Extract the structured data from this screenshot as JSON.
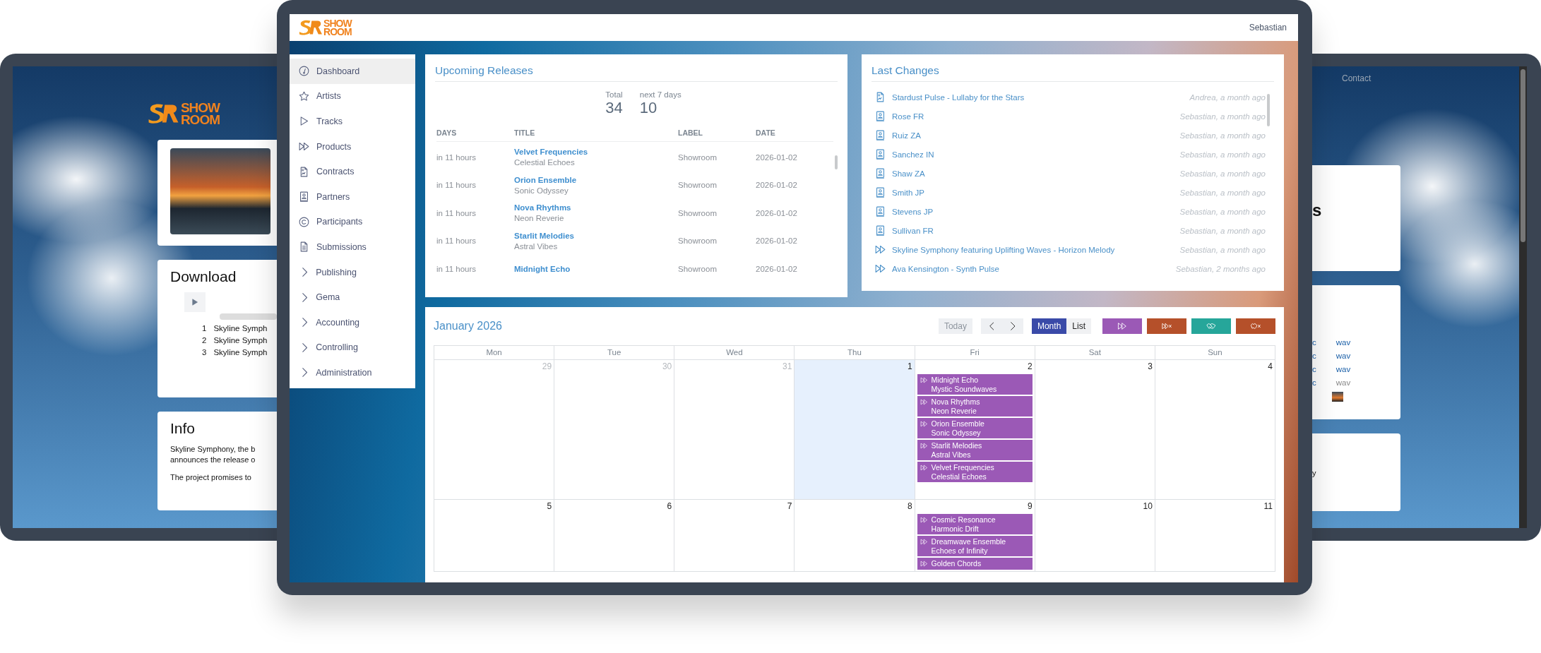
{
  "left_preview": {
    "logo": {
      "line1": "SHOW",
      "line2": "ROOM"
    },
    "download": {
      "title": "Download",
      "tracks": [
        {
          "number": "1",
          "title": "Skyline Symph"
        },
        {
          "number": "2",
          "title": "Skyline Symph"
        },
        {
          "number": "3",
          "title": "Skyline Symph"
        }
      ]
    },
    "info": {
      "title": "Info",
      "paragraphs": [
        [
          "Skyline Symphony, the b",
          "announces the release o"
        ],
        [
          "The project promises to"
        ]
      ]
    }
  },
  "right_preview": {
    "nav_link": "Contact",
    "heading": "s",
    "files": [
      {
        "format": "c",
        "file": "wav",
        "available": true
      },
      {
        "format": "c",
        "file": "wav",
        "available": true
      },
      {
        "format": "c",
        "file": "wav",
        "available": true
      },
      {
        "format": "c",
        "file": "wav",
        "available": false
      }
    ],
    "info_text": "y"
  },
  "app": {
    "logo": {
      "line1": "SHOW",
      "line2": "ROOM"
    },
    "user": "Sebastian",
    "sidebar": {
      "items": [
        {
          "label": "Dashboard",
          "kind": "page",
          "selected": true
        },
        {
          "label": "Artists",
          "kind": "page",
          "selected": false
        },
        {
          "label": "Tracks",
          "kind": "page",
          "selected": false
        },
        {
          "label": "Products",
          "kind": "page",
          "selected": false
        },
        {
          "label": "Contracts",
          "kind": "page",
          "selected": false
        },
        {
          "label": "Partners",
          "kind": "page",
          "selected": false
        },
        {
          "label": "Participants",
          "kind": "page",
          "selected": false
        },
        {
          "label": "Submissions",
          "kind": "page",
          "selected": false
        },
        {
          "label": "Publishing",
          "kind": "group",
          "selected": false
        },
        {
          "label": "Gema",
          "kind": "group",
          "selected": false
        },
        {
          "label": "Accounting",
          "kind": "group",
          "selected": false
        },
        {
          "label": "Controlling",
          "kind": "group",
          "selected": false
        },
        {
          "label": "Administration",
          "kind": "group",
          "selected": false
        }
      ]
    },
    "upcoming_releases": {
      "title": "Upcoming Releases",
      "stats": [
        {
          "label": "Total",
          "value": "34"
        },
        {
          "label": "next 7 days",
          "value": "10"
        }
      ],
      "columns": [
        "DAYS",
        "TITLE",
        "LABEL",
        "DATE"
      ],
      "rows": [
        {
          "days": "in 11 hours",
          "title": "Velvet Frequencies",
          "subtitle": "Celestial Echoes",
          "label": "Showroom",
          "date": "2026-01-02"
        },
        {
          "days": "in 11 hours",
          "title": "Orion Ensemble",
          "subtitle": "Sonic Odyssey",
          "label": "Showroom",
          "date": "2026-01-02"
        },
        {
          "days": "in 11 hours",
          "title": "Nova Rhythms",
          "subtitle": "Neon Reverie",
          "label": "Showroom",
          "date": "2026-01-02"
        },
        {
          "days": "in 11 hours",
          "title": "Starlit Melodies",
          "subtitle": "Astral Vibes",
          "label": "Showroom",
          "date": "2026-01-02"
        },
        {
          "days": "in 11 hours",
          "title": "Midnight Echo",
          "label": "Showroom",
          "date": "2026-01-02"
        }
      ]
    },
    "last_changes": {
      "title": "Last Changes",
      "items": [
        {
          "kind": "contract",
          "title": "Stardust Pulse - Lullaby for the Stars",
          "meta": "Andrea, a month ago"
        },
        {
          "kind": "partner",
          "title": "Rose FR",
          "meta": "Sebastian, a month ago"
        },
        {
          "kind": "partner",
          "title": "Ruiz ZA",
          "meta": "Sebastian, a month ago"
        },
        {
          "kind": "partner",
          "title": "Sanchez IN",
          "meta": "Sebastian, a month ago"
        },
        {
          "kind": "partner",
          "title": "Shaw ZA",
          "meta": "Sebastian, a month ago"
        },
        {
          "kind": "partner",
          "title": "Smith JP",
          "meta": "Sebastian, a month ago"
        },
        {
          "kind": "partner",
          "title": "Stevens JP",
          "meta": "Sebastian, a month ago"
        },
        {
          "kind": "partner",
          "title": "Sullivan FR",
          "meta": "Sebastian, a month ago"
        },
        {
          "kind": "product",
          "title": "Skyline Symphony featuring Uplifting Waves - Horizon Melody",
          "meta": "Sebastian, a month ago"
        },
        {
          "kind": "product",
          "title": "Ava Kensington - Synth Pulse",
          "meta": "Sebastian, 2 months ago"
        }
      ]
    },
    "calendar": {
      "title": "January 2026",
      "today_button": {
        "label": "Today",
        "disabled": true
      },
      "view_buttons": [
        {
          "label": "Month",
          "selected": true
        },
        {
          "label": "List",
          "selected": false
        }
      ],
      "action_buttons": [
        {
          "kind": "products",
          "color": "#9b59b6"
        },
        {
          "kind": "products_off",
          "color": "#b5502a"
        },
        {
          "kind": "deals",
          "color": "#26a69a"
        },
        {
          "kind": "deals_off",
          "color": "#b5502a"
        }
      ],
      "weekdays": [
        "Mon",
        "Tue",
        "Wed",
        "Thu",
        "Fri",
        "Sat",
        "Sun"
      ],
      "weeks": [
        [
          {
            "day": "29",
            "other_month": true,
            "today": false
          },
          {
            "day": "30",
            "other_month": true,
            "today": false
          },
          {
            "day": "31",
            "other_month": true,
            "today": false
          },
          {
            "day": "1",
            "other_month": false,
            "today": true
          },
          {
            "day": "2",
            "other_month": false,
            "today": false,
            "events": [
              {
                "title": "Midnight Echo",
                "subtitle": "Mystic Soundwaves"
              },
              {
                "title": "Nova Rhythms",
                "subtitle": "Neon Reverie"
              },
              {
                "title": "Orion Ensemble",
                "subtitle": "Sonic Odyssey"
              },
              {
                "title": "Starlit Melodies",
                "subtitle": "Astral Vibes"
              },
              {
                "title": "Velvet Frequencies",
                "subtitle": "Celestial Echoes"
              }
            ]
          },
          {
            "day": "3",
            "other_month": false,
            "today": false
          },
          {
            "day": "4",
            "other_month": false,
            "today": false
          }
        ],
        [
          {
            "day": "5",
            "other_month": false,
            "today": false
          },
          {
            "day": "6",
            "other_month": false,
            "today": false
          },
          {
            "day": "7",
            "other_month": false,
            "today": false
          },
          {
            "day": "8",
            "other_month": false,
            "today": false
          },
          {
            "day": "9",
            "other_month": false,
            "today": false,
            "events": [
              {
                "title": "Cosmic Resonance",
                "subtitle": "Harmonic Drift"
              },
              {
                "title": "Dreamwave Ensemble",
                "subtitle": "Echoes of Infinity"
              },
              {
                "title": "Golden Chords"
              }
            ]
          },
          {
            "day": "10",
            "other_month": false,
            "today": false
          },
          {
            "day": "11",
            "other_month": false,
            "today": false
          }
        ]
      ]
    }
  }
}
